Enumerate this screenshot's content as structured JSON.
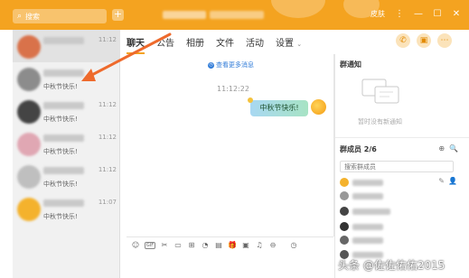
{
  "titlebar": {
    "search_placeholder": "搜索",
    "plus_label": "+",
    "controls": [
      "⋮",
      "≡",
      "—",
      "☐",
      "✕"
    ],
    "skin_label": "皮肤"
  },
  "contacts": [
    {
      "time": "11:12",
      "message": ""
    },
    {
      "time": "",
      "message": "中秋节快乐!"
    },
    {
      "time": "11:12",
      "message": "中秋节快乐!"
    },
    {
      "time": "11:12",
      "message": "中秋节快乐!"
    },
    {
      "time": "11:12",
      "message": "中秋节快乐!"
    },
    {
      "time": "11:07",
      "message": "中秋节快乐!"
    }
  ],
  "tabs": [
    "聊天",
    "公告",
    "相册",
    "文件",
    "活动",
    "设置"
  ],
  "tabs_more_icon": "chevron-down-icon",
  "header_actions": [
    "phone-icon",
    "screen-share-icon",
    "more-icon"
  ],
  "chat": {
    "history_link": "查看更多消息",
    "message_time": "11:12:22",
    "message_text": "中秋节快乐!"
  },
  "toolbar": {
    "items": [
      "☺",
      "GIF",
      "✂",
      "▭",
      "⊞",
      "◔",
      "▤",
      "🎁",
      "▣",
      "♫",
      "⊖",
      "◷"
    ]
  },
  "right_panel": {
    "notice_title": "群通知",
    "notice_empty": "暂时没有新通知",
    "members_title": "群成员 2/6",
    "member_search_placeholder": "搜索群成员",
    "member_tools": [
      "⊕",
      "🔍"
    ],
    "member_row_actions": [
      "✎",
      "👤"
    ]
  },
  "watermark": "头条 @佐佐佑佑2015",
  "colors": {
    "accent": "#f4a320",
    "bubble_from": "#a8d8f2",
    "bubble_to": "#a7e3c4",
    "arrow": "#ee6a2c"
  }
}
